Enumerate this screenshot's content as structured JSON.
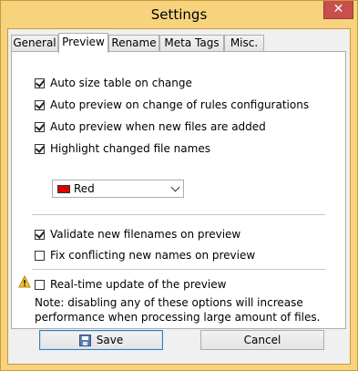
{
  "window": {
    "title": "Settings",
    "close_glyph": "✕"
  },
  "tabs": [
    {
      "label": "General",
      "active": false
    },
    {
      "label": "Preview",
      "active": true
    },
    {
      "label": "Rename",
      "active": false
    },
    {
      "label": "Meta Tags",
      "active": false
    },
    {
      "label": "Misc.",
      "active": false
    }
  ],
  "options": {
    "auto_size": {
      "label": "Auto size table on change",
      "checked": true
    },
    "auto_preview_rules": {
      "label": "Auto preview on change of rules configurations",
      "checked": true
    },
    "auto_preview_files": {
      "label": "Auto preview when new files are added",
      "checked": true
    },
    "highlight": {
      "label": "Highlight changed file names",
      "checked": true
    },
    "validate": {
      "label": "Validate new filenames on preview",
      "checked": true
    },
    "fix_conflicts": {
      "label": "Fix conflicting new names on preview",
      "checked": false
    },
    "realtime": {
      "label": "Real-time update of the preview",
      "checked": false
    }
  },
  "highlight_color": {
    "value": "Red",
    "swatch": "#e00000"
  },
  "note": "Note: disabling any of these options will increase performance when processing large amount of files.",
  "icons": {
    "warning": "warning-icon",
    "save": "floppy-disk-icon"
  },
  "buttons": {
    "save": "Save",
    "cancel": "Cancel"
  }
}
